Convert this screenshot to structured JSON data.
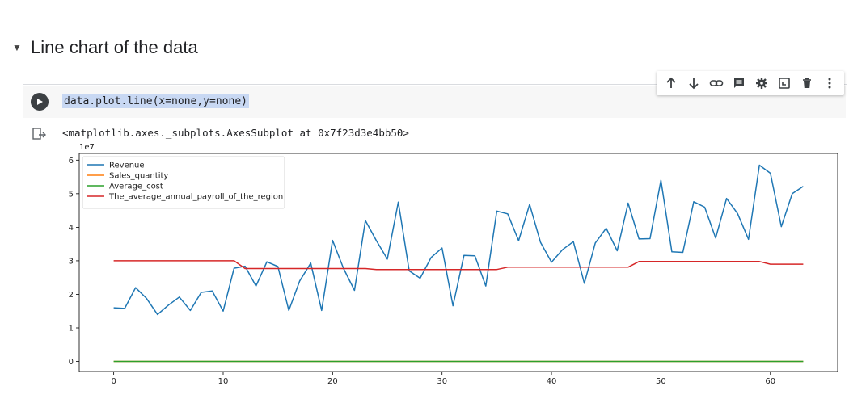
{
  "section": {
    "title": "Line chart of the data",
    "caret_icon": "caret-down-icon"
  },
  "toolbar": {
    "icons": [
      "arrow-up-icon",
      "arrow-down-icon",
      "link-icon",
      "comment-icon",
      "gear-icon",
      "mirror-cell-icon",
      "delete-icon",
      "more-vert-icon"
    ]
  },
  "cell": {
    "code": "data.plot.line(x=none,y=none)",
    "output": "<matplotlib.axes._subplots.AxesSubplot at 0x7f23d3e4bb50>"
  },
  "chart_data": {
    "type": "line",
    "title": "",
    "xlabel": "",
    "ylabel": "",
    "scale_label": "1e7",
    "xlim": [
      -3.15,
      66.15
    ],
    "ylim": [
      -0.3,
      6.2
    ],
    "xticks": [
      0,
      10,
      20,
      30,
      40,
      50,
      60
    ],
    "yticks": [
      0,
      1,
      2,
      3,
      4,
      5,
      6
    ],
    "legend_position": "top-left",
    "x": [
      0,
      1,
      2,
      3,
      4,
      5,
      6,
      7,
      8,
      9,
      10,
      11,
      12,
      13,
      14,
      15,
      16,
      17,
      18,
      19,
      20,
      21,
      22,
      23,
      24,
      25,
      26,
      27,
      28,
      29,
      30,
      31,
      32,
      33,
      34,
      35,
      36,
      37,
      38,
      39,
      40,
      41,
      42,
      43,
      44,
      45,
      46,
      47,
      48,
      49,
      50,
      51,
      52,
      53,
      54,
      55,
      56,
      57,
      58,
      59,
      60,
      61,
      62,
      63
    ],
    "series": [
      {
        "name": "Revenue",
        "color": "#1f77b4",
        "values": [
          1.6,
          1.58,
          2.2,
          1.88,
          1.4,
          1.68,
          1.92,
          1.52,
          2.06,
          2.1,
          1.5,
          2.78,
          2.84,
          2.25,
          2.97,
          2.83,
          1.52,
          2.4,
          2.93,
          1.52,
          3.61,
          2.77,
          2.12,
          4.2,
          3.6,
          3.05,
          4.75,
          2.7,
          2.48,
          3.1,
          3.38,
          1.66,
          3.16,
          3.15,
          2.25,
          4.48,
          4.4,
          3.6,
          4.68,
          3.55,
          2.96,
          3.33,
          3.57,
          2.33,
          3.53,
          3.97,
          3.3,
          4.72,
          3.65,
          3.66,
          5.4,
          3.27,
          3.25,
          4.76,
          4.6,
          3.68,
          4.86,
          4.41,
          3.64,
          5.85,
          5.61,
          4.02,
          5.0,
          5.22
        ]
      },
      {
        "name": "Sales_quantity",
        "color": "#ff7f0e",
        "values": [
          0,
          0,
          0,
          0,
          0,
          0,
          0,
          0,
          0,
          0,
          0,
          0,
          0,
          0,
          0,
          0,
          0,
          0,
          0,
          0,
          0,
          0,
          0,
          0,
          0,
          0,
          0,
          0,
          0,
          0,
          0,
          0,
          0,
          0,
          0,
          0,
          0,
          0,
          0,
          0,
          0,
          0,
          0,
          0,
          0,
          0,
          0,
          0,
          0,
          0,
          0,
          0,
          0,
          0,
          0,
          0,
          0,
          0,
          0,
          0,
          0,
          0,
          0,
          0
        ]
      },
      {
        "name": "Average_cost",
        "color": "#2ca02c",
        "values": [
          0,
          0,
          0,
          0,
          0,
          0,
          0,
          0,
          0,
          0,
          0,
          0,
          0,
          0,
          0,
          0,
          0,
          0,
          0,
          0,
          0,
          0,
          0,
          0,
          0,
          0,
          0,
          0,
          0,
          0,
          0,
          0,
          0,
          0,
          0,
          0,
          0,
          0,
          0,
          0,
          0,
          0,
          0,
          0,
          0,
          0,
          0,
          0,
          0,
          0,
          0,
          0,
          0,
          0,
          0,
          0,
          0,
          0,
          0,
          0,
          0,
          0,
          0,
          0
        ]
      },
      {
        "name": "The_average_annual_payroll_of_the_region",
        "color": "#d62728",
        "values": [
          3.0,
          3.0,
          3.0,
          3.0,
          3.0,
          3.0,
          3.0,
          3.0,
          3.0,
          3.0,
          3.0,
          3.0,
          2.77,
          2.77,
          2.77,
          2.77,
          2.77,
          2.77,
          2.77,
          2.77,
          2.77,
          2.77,
          2.77,
          2.77,
          2.74,
          2.74,
          2.74,
          2.74,
          2.74,
          2.74,
          2.74,
          2.74,
          2.74,
          2.74,
          2.74,
          2.74,
          2.81,
          2.81,
          2.81,
          2.81,
          2.81,
          2.81,
          2.81,
          2.81,
          2.81,
          2.81,
          2.81,
          2.81,
          2.98,
          2.98,
          2.98,
          2.98,
          2.98,
          2.98,
          2.98,
          2.98,
          2.98,
          2.98,
          2.98,
          2.98,
          2.9,
          2.9,
          2.9,
          2.9
        ]
      }
    ]
  }
}
